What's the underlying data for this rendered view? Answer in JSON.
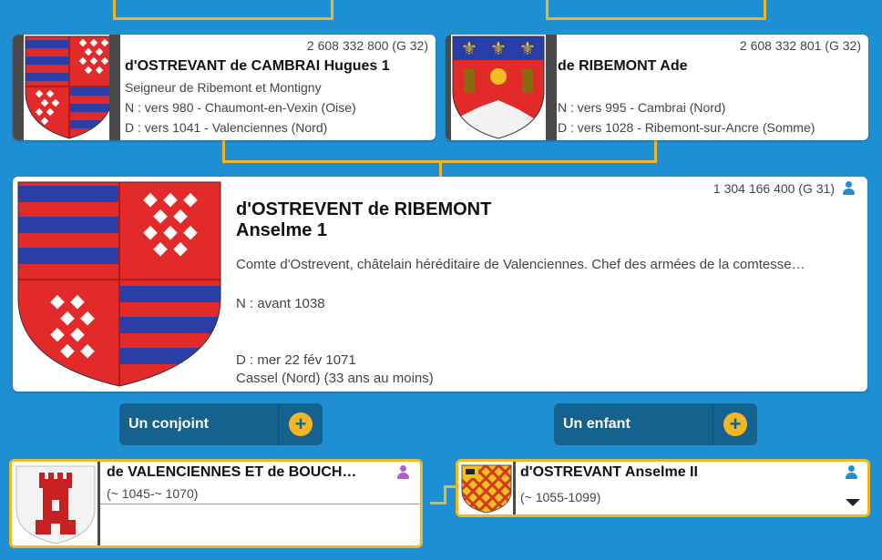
{
  "father": {
    "sosa": "2 608 332 800 (G 32)",
    "name": "d'OSTREVANT de CAMBRAI Hugues 1",
    "title": "Seigneur de Ribemont et Montigny",
    "birth": "N : vers 980 - Chaumont-en-Vexin (Oise)",
    "death": "D : vers 1041 - Valenciennes (Nord)"
  },
  "mother": {
    "sosa": "2 608 332 801 (G 32)",
    "name": "de RIBEMONT Ade",
    "birth": "N : vers 995 - Cambrai (Nord)",
    "death": "D : vers 1028 - Ribemont-sur-Ancre (Somme)"
  },
  "main": {
    "sosa": "1 304 166 400 (G 31)",
    "name_line1": "d'OSTREVENT de RIBEMONT",
    "name_line2": "Anselme 1",
    "description": "Comte d'Ostrevent, châtelain héréditaire de Valenciennes. Chef des armées de la comtesse…",
    "birth": "N : avant 1038",
    "death_line1": "D : mer 22 fév 1071",
    "death_line2": "Cassel (Nord) (33 ans au moins)"
  },
  "buttons": {
    "spouse_label": "Un conjoint",
    "child_label": "Un enfant",
    "plus": "+"
  },
  "spouse": {
    "name": "de VALENCIENNES ET de BOUCH…",
    "dates": "(~ 1045-~ 1070)"
  },
  "child": {
    "name": "d'OSTREVANT Anselme II",
    "dates": "(~ 1055-1099)"
  },
  "colors": {
    "background": "#1f8fd3",
    "connector": "#f0b429",
    "button": "#16628f",
    "accent_yellow": "#f5b624",
    "male_icon": "#1f8fd3",
    "female_icon": "#b45bd0"
  }
}
